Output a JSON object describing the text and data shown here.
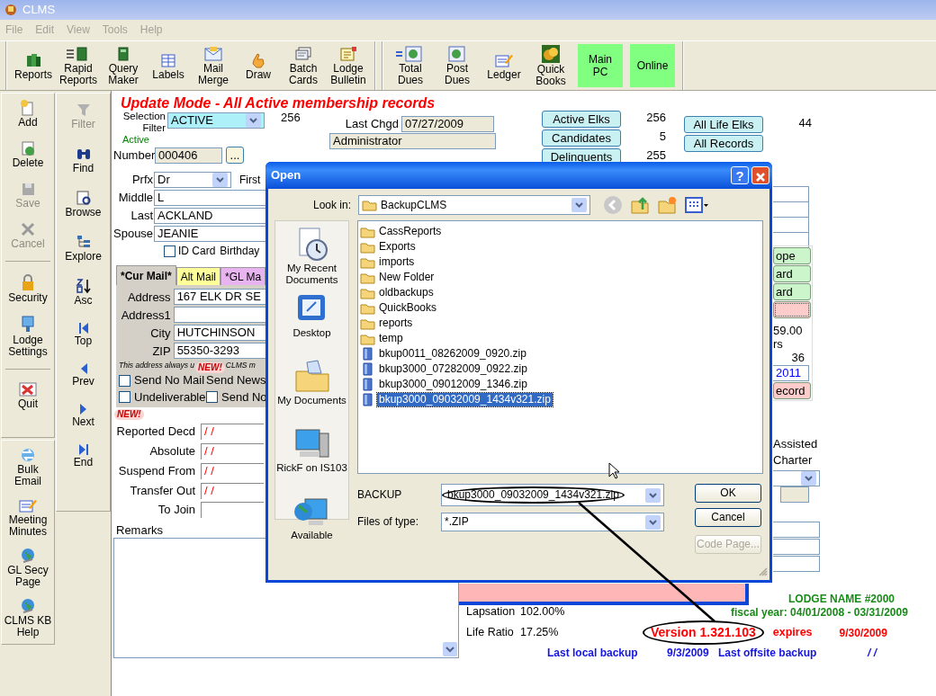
{
  "window": {
    "title": "CLMS"
  },
  "menu": [
    {
      "label": "File",
      "disabled": true
    },
    {
      "label": "Edit",
      "disabled": true
    },
    {
      "label": "View",
      "disabled": true
    },
    {
      "label": "Tools",
      "disabled": true
    },
    {
      "label": "Help",
      "disabled": true
    }
  ],
  "toolbar": {
    "groups": [
      [
        {
          "label": "Reports",
          "kind": "tool"
        },
        {
          "label": "Rapid Reports",
          "kind": "tool"
        },
        {
          "label": "Query Maker",
          "kind": "tool"
        },
        {
          "label": "Labels",
          "kind": "tool"
        },
        {
          "label": "Mail Merge",
          "kind": "tool"
        },
        {
          "label": "Draw",
          "kind": "tool"
        },
        {
          "label": "Batch Cards",
          "kind": "tool"
        },
        {
          "label": "Lodge Bulletin",
          "kind": "tool"
        }
      ],
      [
        {
          "label": "Total Dues",
          "kind": "tool"
        },
        {
          "label": "Post Dues",
          "kind": "tool"
        },
        {
          "label": "Ledger",
          "kind": "tool"
        },
        {
          "label": "Quick Books",
          "kind": "tool"
        },
        {
          "label": "Main PC",
          "kind": "indicator"
        },
        {
          "label": "Online",
          "kind": "indicator"
        }
      ]
    ]
  },
  "sidebar": {
    "panels": [
      [
        {
          "label": "Add",
          "disabled": false
        },
        {
          "label": "Delete",
          "disabled": false
        },
        {
          "label": "Save",
          "disabled": true
        },
        {
          "label": "Cancel",
          "disabled": true
        },
        {
          "label": "Security",
          "disabled": false
        },
        {
          "label": "Lodge Settings",
          "disabled": false
        },
        {
          "label": "Quit",
          "disabled": false
        }
      ],
      [
        {
          "label": "Bulk Email",
          "disabled": false
        },
        {
          "label": "Meeting Minutes",
          "disabled": false
        },
        {
          "label": "GL Secy Page",
          "disabled": false
        },
        {
          "label": "CLMS KB Help",
          "disabled": false
        }
      ]
    ]
  },
  "navigation": [
    {
      "label": "Filter",
      "disabled": true
    },
    {
      "label": "Find",
      "disabled": false
    },
    {
      "label": "Browse",
      "disabled": false
    },
    {
      "label": "Explore",
      "disabled": false
    },
    {
      "label": "Asc",
      "disabled": false
    },
    {
      "label": "Top",
      "disabled": false
    },
    {
      "label": "Prev",
      "disabled": false
    },
    {
      "label": "Next",
      "disabled": false
    },
    {
      "label": "End",
      "disabled": false
    }
  ],
  "header": {
    "title": "Update Mode - All Active membership records"
  },
  "selection": {
    "label": "Selection Filter",
    "value": "ACTIVE",
    "count": "256",
    "status": "Active"
  },
  "last_changed": {
    "label": "Last Chgd",
    "value": "07/27/2009",
    "user": "Administrator"
  },
  "quick_buttons": [
    [
      {
        "label": "Active Elks",
        "count": "256"
      },
      {
        "label": "Candidates",
        "count": "5"
      },
      {
        "label": "Delinquents",
        "count": "255"
      }
    ],
    [
      {
        "label": "All Life Elks",
        "count": "44"
      },
      {
        "label": "All Records"
      }
    ]
  ],
  "member": {
    "number_label": "Number",
    "number": "000406",
    "lookup_button": "...",
    "prefix_label": "Prfx",
    "prefix": "Dr",
    "first_label": "First",
    "middle_label": "Middle",
    "middle": "L",
    "last_label": "Last",
    "last": "ACKLAND",
    "spouse_label": "Spouse",
    "spouse": "JEANIE",
    "id_card": {
      "label": "ID Card",
      "checked": false
    },
    "birthday_label": "Birthday"
  },
  "mail_tabs": [
    {
      "label": "*Cur Mail*",
      "selected": true,
      "color": "#d4d0c8"
    },
    {
      "label": "Alt Mail",
      "selected": false,
      "color": "#ffff99"
    },
    {
      "label": "*GL Ma",
      "selected": false,
      "color": "#e8b4f0"
    }
  ],
  "address": {
    "fields": [
      {
        "label": "Address",
        "value": "167 ELK DR SE"
      },
      {
        "label": "Address1"
      },
      {
        "label": "City",
        "value": "HUTCHINSON"
      },
      {
        "label": "ZIP",
        "value": "55350-3293"
      }
    ],
    "note_start": "This address always u",
    "badge": "NEW!",
    "note_end": "CLMS m",
    "options": [
      {
        "kind": "checkbox",
        "label": "Send No Mail",
        "checked": false
      },
      {
        "kind": "text",
        "label": "Send News"
      },
      {
        "kind": "checkbox",
        "label": "Undeliverable",
        "checked": false
      },
      {
        "kind": "checkbox",
        "label": "Send No",
        "checked": false
      }
    ]
  },
  "dates_badge": "NEW!",
  "dates": [
    {
      "label": "Reported Decd",
      "value": "/ /"
    },
    {
      "label": "Absolute",
      "value": "/ /"
    },
    {
      "label": "Suspend From",
      "value": "/ /"
    },
    {
      "label": "Transfer Out",
      "value": "/ /"
    },
    {
      "label": "To Join"
    }
  ],
  "remarks": {
    "label": "Remarks"
  },
  "right_panel": {
    "buttons": [
      {
        "label": "ope",
        "color": "#ccf5cc",
        "focused": false
      },
      {
        "label": "ard",
        "color": "#ccf5cc",
        "focused": false
      },
      {
        "label": "ard",
        "color": "#ccf5cc",
        "focused": false
      },
      {
        "color": "#ffcccc",
        "focused": true
      }
    ],
    "amount": "59.00",
    "fragment": "rs",
    "count": "36",
    "year": "2011",
    "record_button": {
      "label": "ecord",
      "color": "#ffcccc"
    },
    "labels": [
      "Assisted",
      "Charter"
    ]
  },
  "stats": [
    {
      "label": "Lapsation",
      "value": "102.00%"
    },
    {
      "label": "Life Ratio",
      "value": "17.25%"
    }
  ],
  "footer": {
    "lodge_name": "LODGE NAME #2000",
    "fiscal_year": "fiscal year: 04/01/2008 - 03/31/2009",
    "version": "Version 1.321.103",
    "expires_label": "expires",
    "expires": "9/30/2009",
    "local_label": "Last local backup",
    "local_date": "9/3/2009",
    "offsite_label": "Last offsite backup",
    "offsite_date": "/ /"
  },
  "dialog": {
    "title": "Open",
    "help_button": "?",
    "look_in_label": "Look in:",
    "look_in": "BackupCLMS",
    "places": [
      {
        "label": "My Recent Documents"
      },
      {
        "label": "Desktop"
      },
      {
        "label": "My Documents"
      },
      {
        "label": "RickF on IS103"
      },
      {
        "label": "Available"
      }
    ],
    "files": [
      {
        "name": "CassReports",
        "kind": "folder",
        "selected": false
      },
      {
        "name": "Exports",
        "kind": "folder",
        "selected": false
      },
      {
        "name": "imports",
        "kind": "folder",
        "selected": false
      },
      {
        "name": "New Folder",
        "kind": "folder",
        "selected": false
      },
      {
        "name": "oldbackups",
        "kind": "folder",
        "selected": false
      },
      {
        "name": "QuickBooks",
        "kind": "folder",
        "selected": false
      },
      {
        "name": "reports",
        "kind": "folder",
        "selected": false
      },
      {
        "name": "temp",
        "kind": "folder",
        "selected": false
      },
      {
        "name": "bkup0011_08262009_0920.zip",
        "kind": "file",
        "selected": false
      },
      {
        "name": "bkup3000_07282009_0922.zip",
        "kind": "file",
        "selected": false
      },
      {
        "name": "bkup3000_09012009_1346.zip",
        "kind": "file",
        "selected": false
      },
      {
        "name": "bkup3000_09032009_1434v321.zip",
        "kind": "file",
        "selected": true
      }
    ],
    "filename_label": "BACKUP",
    "filename": "bkup3000_09032009_1434v321.zip",
    "type_label": "Files of type:",
    "type": "*.ZIP",
    "buttons": [
      {
        "label": "OK",
        "disabled": false
      },
      {
        "label": "Cancel",
        "disabled": false
      },
      {
        "label": "Code Page...",
        "disabled": true
      }
    ]
  }
}
